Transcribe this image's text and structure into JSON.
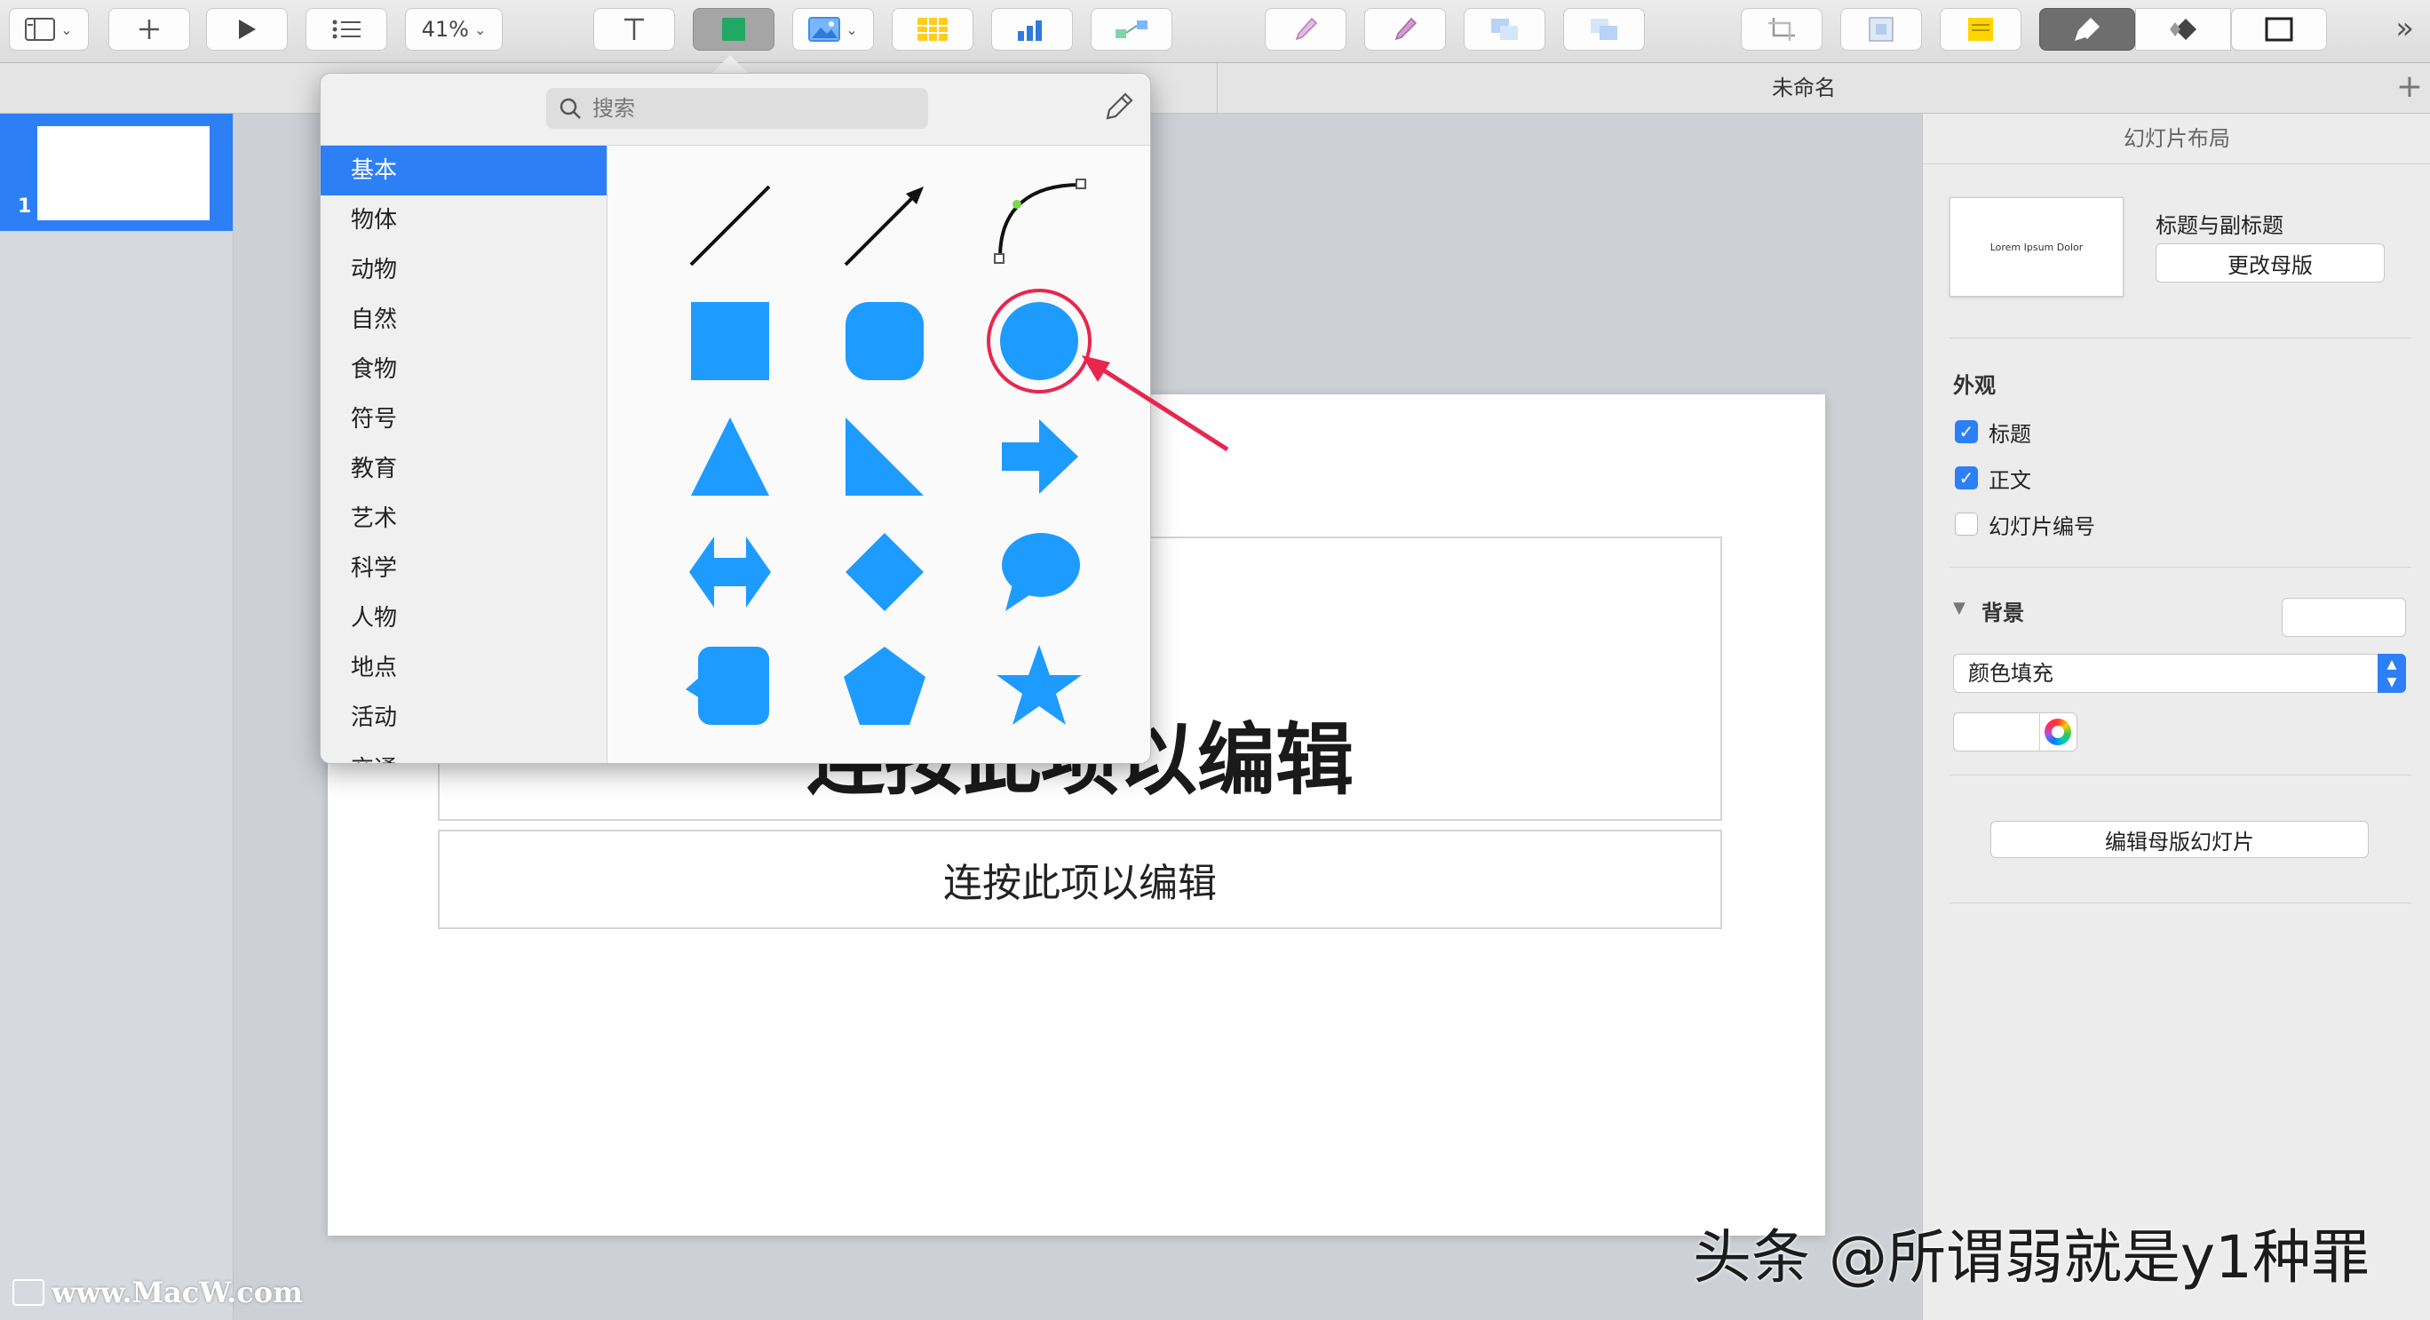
{
  "toolbar": {
    "zoom_label": "41%",
    "buttons": [
      "view-menu",
      "add-slide",
      "play",
      "bullets",
      "zoom",
      "text",
      "shape",
      "media",
      "table",
      "chart",
      "connection",
      "format-1",
      "format-2",
      "arrange-1",
      "arrange-2",
      "crop",
      "mask",
      "comment",
      "format-inspector",
      "animate-inspector",
      "document-inspector"
    ]
  },
  "document": {
    "title": "未命名"
  },
  "navigator": {
    "slides": [
      {
        "number": "1"
      }
    ]
  },
  "slide": {
    "title_placeholder": "连按此项以编辑",
    "subtitle_placeholder": "连按此项以编辑"
  },
  "shape_picker": {
    "search_placeholder": "搜索",
    "categories": [
      "基本",
      "物体",
      "动物",
      "自然",
      "食物",
      "符号",
      "教育",
      "艺术",
      "科学",
      "人物",
      "地点",
      "活动",
      "交通"
    ],
    "selected_category": "基本",
    "shape_color": "#1e9bff",
    "shapes": [
      "line",
      "arrow-line",
      "curve",
      "square",
      "rounded-square",
      "circle",
      "triangle",
      "right-triangle",
      "arrow",
      "double-arrow",
      "diamond",
      "speech-bubble",
      "callout-square",
      "pentagon",
      "star"
    ],
    "highlighted_shape": "circle"
  },
  "inspector": {
    "title": "幻灯片布局",
    "master_thumbnail_text": "Lorem Ipsum Dolor",
    "master_name": "标题与副标题",
    "change_master_label": "更改母版",
    "appearance_label": "外观",
    "appearance_options": [
      {
        "label": "标题",
        "checked": true
      },
      {
        "label": "正文",
        "checked": true
      },
      {
        "label": "幻灯片编号",
        "checked": false
      }
    ],
    "background_label": "背景",
    "fill_type": "颜色填充",
    "edit_master_label": "编辑母版幻灯片"
  },
  "watermarks": {
    "left": "www.MacW.com",
    "right": "头条 @所谓弱就是y1种罪"
  },
  "colors": {
    "accent": "#2d7ff5",
    "shape_blue": "#1e9bff",
    "highlight_red": "#e8264e"
  }
}
